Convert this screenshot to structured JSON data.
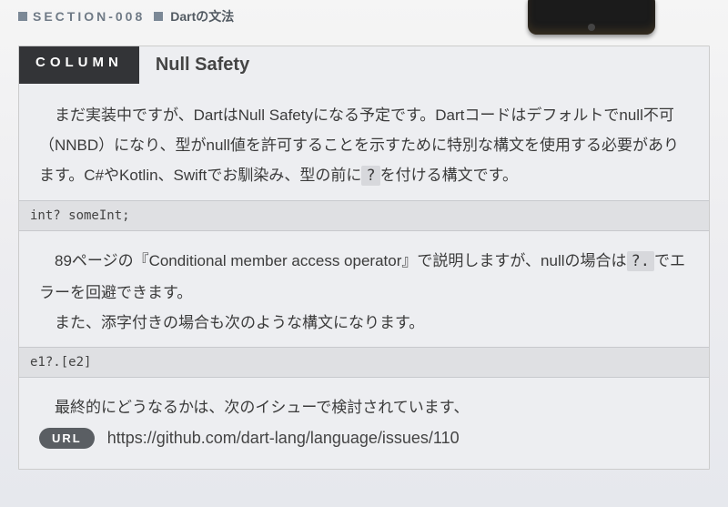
{
  "header": {
    "section_label": "SECTION-008",
    "section_title": "Dartの文法"
  },
  "column": {
    "badge": "COLUMN",
    "title": "Null Safety",
    "para1_a": "まだ実装中ですが、DartはNull Safetyになる予定です。Dartコードはデフォルトでnull不可（NNBD）になり、型がnull値を許可することを示すために特別な構文を使用する必要があります。C#やKotlin、Swiftでお馴染み、型の前に",
    "para1_code": "?",
    "para1_b": "を付ける構文です。",
    "code1": "int? someInt;",
    "para2_a": "89ページの『Conditional member access operator』で説明しますが、nullの場合は",
    "para2_code": "?.",
    "para2_b": "でエラーを回避できます。",
    "para3": "また、添字付きの場合も次のような構文になります。",
    "code2": "e1?.[e2]",
    "para4": "最終的にどうなるかは、次のイシューで検討されています、",
    "url_badge": "URL",
    "url": "https://github.com/dart-lang/language/issues/110"
  }
}
